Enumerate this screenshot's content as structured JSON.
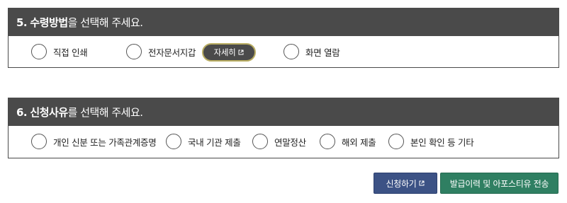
{
  "section5": {
    "number": "5.",
    "title_bold": "수령방법",
    "title_rest": "을 선택해 주세요.",
    "options": [
      {
        "label": "직접 인쇄"
      },
      {
        "label": "전자문서지갑"
      },
      {
        "label": "화면 열람"
      }
    ],
    "detail_button": "자세히",
    "detail_icon": "external-link-icon"
  },
  "section6": {
    "number": "6.",
    "title_bold": "신청사유",
    "title_rest": "를 선택해 주세요.",
    "options": [
      {
        "label": "개인 신분 또는 가족관계증명"
      },
      {
        "label": "국내 기관 제출"
      },
      {
        "label": "연말정산"
      },
      {
        "label": "해외 제출"
      },
      {
        "label": "본인 확인 등 기타"
      }
    ]
  },
  "actions": {
    "apply_label": "신청하기",
    "apply_icon": "external-link-icon",
    "history_label": "발급이력 및 아포스티유 전송"
  },
  "colors": {
    "header_bg": "#4a4a4a",
    "detail_border": "#b9ad62",
    "apply_bg": "#3c5285",
    "history_bg": "#2f7f62"
  }
}
